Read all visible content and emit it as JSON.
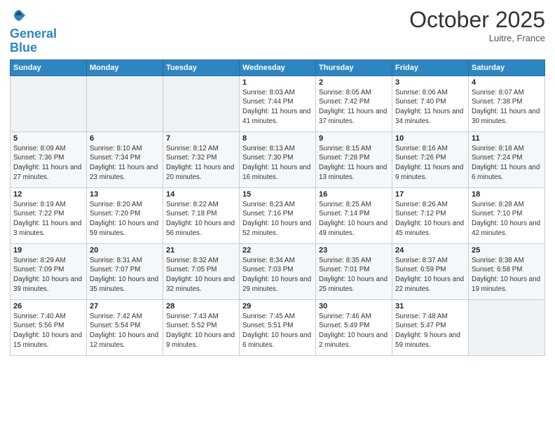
{
  "header": {
    "logo_line1": "General",
    "logo_line2": "Blue",
    "month_title": "October 2025",
    "location": "Luitre, France"
  },
  "weekdays": [
    "Sunday",
    "Monday",
    "Tuesday",
    "Wednesday",
    "Thursday",
    "Friday",
    "Saturday"
  ],
  "weeks": [
    [
      {
        "day": "",
        "sunrise": "",
        "sunset": "",
        "daylight": ""
      },
      {
        "day": "",
        "sunrise": "",
        "sunset": "",
        "daylight": ""
      },
      {
        "day": "",
        "sunrise": "",
        "sunset": "",
        "daylight": ""
      },
      {
        "day": "1",
        "sunrise": "Sunrise: 8:03 AM",
        "sunset": "Sunset: 7:44 PM",
        "daylight": "Daylight: 11 hours and 41 minutes."
      },
      {
        "day": "2",
        "sunrise": "Sunrise: 8:05 AM",
        "sunset": "Sunset: 7:42 PM",
        "daylight": "Daylight: 11 hours and 37 minutes."
      },
      {
        "day": "3",
        "sunrise": "Sunrise: 8:06 AM",
        "sunset": "Sunset: 7:40 PM",
        "daylight": "Daylight: 11 hours and 34 minutes."
      },
      {
        "day": "4",
        "sunrise": "Sunrise: 8:07 AM",
        "sunset": "Sunset: 7:38 PM",
        "daylight": "Daylight: 11 hours and 30 minutes."
      }
    ],
    [
      {
        "day": "5",
        "sunrise": "Sunrise: 8:09 AM",
        "sunset": "Sunset: 7:36 PM",
        "daylight": "Daylight: 11 hours and 27 minutes."
      },
      {
        "day": "6",
        "sunrise": "Sunrise: 8:10 AM",
        "sunset": "Sunset: 7:34 PM",
        "daylight": "Daylight: 11 hours and 23 minutes."
      },
      {
        "day": "7",
        "sunrise": "Sunrise: 8:12 AM",
        "sunset": "Sunset: 7:32 PM",
        "daylight": "Daylight: 11 hours and 20 minutes."
      },
      {
        "day": "8",
        "sunrise": "Sunrise: 8:13 AM",
        "sunset": "Sunset: 7:30 PM",
        "daylight": "Daylight: 11 hours and 16 minutes."
      },
      {
        "day": "9",
        "sunrise": "Sunrise: 8:15 AM",
        "sunset": "Sunset: 7:28 PM",
        "daylight": "Daylight: 11 hours and 13 minutes."
      },
      {
        "day": "10",
        "sunrise": "Sunrise: 8:16 AM",
        "sunset": "Sunset: 7:26 PM",
        "daylight": "Daylight: 11 hours and 9 minutes."
      },
      {
        "day": "11",
        "sunrise": "Sunrise: 8:18 AM",
        "sunset": "Sunset: 7:24 PM",
        "daylight": "Daylight: 11 hours and 6 minutes."
      }
    ],
    [
      {
        "day": "12",
        "sunrise": "Sunrise: 8:19 AM",
        "sunset": "Sunset: 7:22 PM",
        "daylight": "Daylight: 11 hours and 3 minutes."
      },
      {
        "day": "13",
        "sunrise": "Sunrise: 8:20 AM",
        "sunset": "Sunset: 7:20 PM",
        "daylight": "Daylight: 10 hours and 59 minutes."
      },
      {
        "day": "14",
        "sunrise": "Sunrise: 8:22 AM",
        "sunset": "Sunset: 7:18 PM",
        "daylight": "Daylight: 10 hours and 56 minutes."
      },
      {
        "day": "15",
        "sunrise": "Sunrise: 8:23 AM",
        "sunset": "Sunset: 7:16 PM",
        "daylight": "Daylight: 10 hours and 52 minutes."
      },
      {
        "day": "16",
        "sunrise": "Sunrise: 8:25 AM",
        "sunset": "Sunset: 7:14 PM",
        "daylight": "Daylight: 10 hours and 49 minutes."
      },
      {
        "day": "17",
        "sunrise": "Sunrise: 8:26 AM",
        "sunset": "Sunset: 7:12 PM",
        "daylight": "Daylight: 10 hours and 45 minutes."
      },
      {
        "day": "18",
        "sunrise": "Sunrise: 8:28 AM",
        "sunset": "Sunset: 7:10 PM",
        "daylight": "Daylight: 10 hours and 42 minutes."
      }
    ],
    [
      {
        "day": "19",
        "sunrise": "Sunrise: 8:29 AM",
        "sunset": "Sunset: 7:09 PM",
        "daylight": "Daylight: 10 hours and 39 minutes."
      },
      {
        "day": "20",
        "sunrise": "Sunrise: 8:31 AM",
        "sunset": "Sunset: 7:07 PM",
        "daylight": "Daylight: 10 hours and 35 minutes."
      },
      {
        "day": "21",
        "sunrise": "Sunrise: 8:32 AM",
        "sunset": "Sunset: 7:05 PM",
        "daylight": "Daylight: 10 hours and 32 minutes."
      },
      {
        "day": "22",
        "sunrise": "Sunrise: 8:34 AM",
        "sunset": "Sunset: 7:03 PM",
        "daylight": "Daylight: 10 hours and 29 minutes."
      },
      {
        "day": "23",
        "sunrise": "Sunrise: 8:35 AM",
        "sunset": "Sunset: 7:01 PM",
        "daylight": "Daylight: 10 hours and 25 minutes."
      },
      {
        "day": "24",
        "sunrise": "Sunrise: 8:37 AM",
        "sunset": "Sunset: 6:59 PM",
        "daylight": "Daylight: 10 hours and 22 minutes."
      },
      {
        "day": "25",
        "sunrise": "Sunrise: 8:38 AM",
        "sunset": "Sunset: 6:58 PM",
        "daylight": "Daylight: 10 hours and 19 minutes."
      }
    ],
    [
      {
        "day": "26",
        "sunrise": "Sunrise: 7:40 AM",
        "sunset": "Sunset: 5:56 PM",
        "daylight": "Daylight: 10 hours and 15 minutes."
      },
      {
        "day": "27",
        "sunrise": "Sunrise: 7:42 AM",
        "sunset": "Sunset: 5:54 PM",
        "daylight": "Daylight: 10 hours and 12 minutes."
      },
      {
        "day": "28",
        "sunrise": "Sunrise: 7:43 AM",
        "sunset": "Sunset: 5:52 PM",
        "daylight": "Daylight: 10 hours and 9 minutes."
      },
      {
        "day": "29",
        "sunrise": "Sunrise: 7:45 AM",
        "sunset": "Sunset: 5:51 PM",
        "daylight": "Daylight: 10 hours and 6 minutes."
      },
      {
        "day": "30",
        "sunrise": "Sunrise: 7:46 AM",
        "sunset": "Sunset: 5:49 PM",
        "daylight": "Daylight: 10 hours and 2 minutes."
      },
      {
        "day": "31",
        "sunrise": "Sunrise: 7:48 AM",
        "sunset": "Sunset: 5:47 PM",
        "daylight": "Daylight: 9 hours and 59 minutes."
      },
      {
        "day": "",
        "sunrise": "",
        "sunset": "",
        "daylight": ""
      }
    ]
  ]
}
